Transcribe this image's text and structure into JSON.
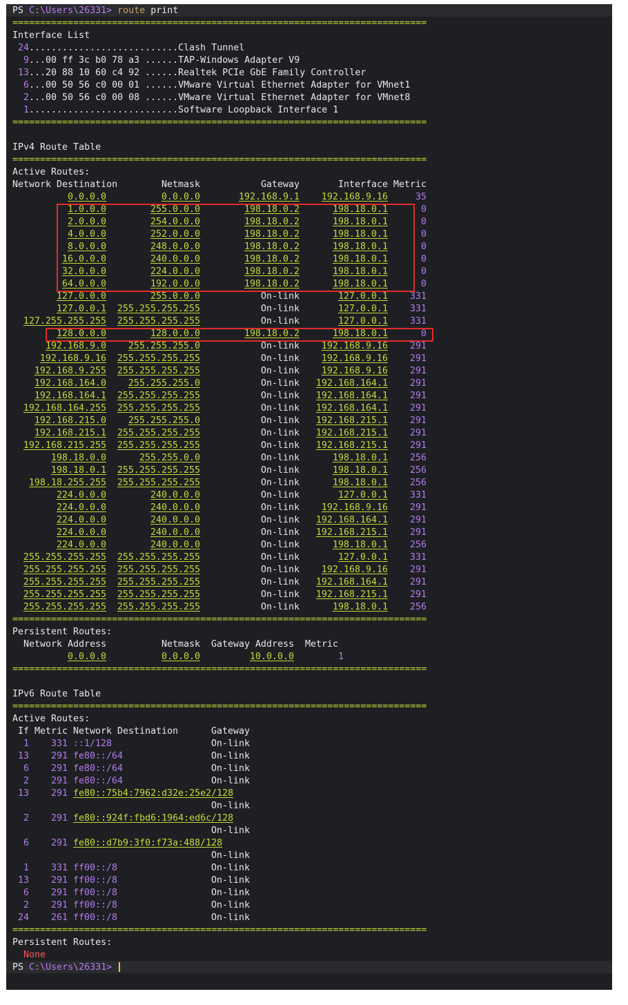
{
  "window": {
    "prompt": "PS",
    "path": "C:\\Users\\26331>",
    "command": "route",
    "command_arg": "print"
  },
  "separator": "===========================================================================",
  "interface_list": {
    "title": "Interface List",
    "items": [
      {
        "num": "24",
        "mac": "",
        "dots": "...........................",
        "name": "Clash Tunnel"
      },
      {
        "num": "9",
        "mac": "...00 ff 3c b0 78 a3 ",
        "dots": "......",
        "name": "TAP-Windows Adapter V9"
      },
      {
        "num": "13",
        "mac": "...20 88 10 60 c4 92 ",
        "dots": "......",
        "name": "Realtek PCIe GbE Family Controller"
      },
      {
        "num": "6",
        "mac": "...00 50 56 c0 00 01 ",
        "dots": "......",
        "name": "VMware Virtual Ethernet Adapter for VMnet1"
      },
      {
        "num": "2",
        "mac": "...00 50 56 c0 00 08 ",
        "dots": "......",
        "name": "VMware Virtual Ethernet Adapter for VMnet8"
      },
      {
        "num": "1",
        "mac": "",
        "dots": "...........................",
        "name": "Software Loopback Interface 1"
      }
    ]
  },
  "ipv4": {
    "title": "IPv4 Route Table",
    "active_title": "Active Routes:",
    "headers": [
      "Network Destination",
      "Netmask",
      "Gateway",
      "Interface",
      "Metric"
    ],
    "rows": [
      [
        "0.0.0.0",
        "0.0.0.0",
        "192.168.9.1",
        "192.168.9.16",
        "35"
      ],
      [
        "1.0.0.0",
        "255.0.0.0",
        "198.18.0.2",
        "198.18.0.1",
        "0"
      ],
      [
        "2.0.0.0",
        "254.0.0.0",
        "198.18.0.2",
        "198.18.0.1",
        "0"
      ],
      [
        "4.0.0.0",
        "252.0.0.0",
        "198.18.0.2",
        "198.18.0.1",
        "0"
      ],
      [
        "8.0.0.0",
        "248.0.0.0",
        "198.18.0.2",
        "198.18.0.1",
        "0"
      ],
      [
        "16.0.0.0",
        "240.0.0.0",
        "198.18.0.2",
        "198.18.0.1",
        "0"
      ],
      [
        "32.0.0.0",
        "224.0.0.0",
        "198.18.0.2",
        "198.18.0.1",
        "0"
      ],
      [
        "64.0.0.0",
        "192.0.0.0",
        "198.18.0.2",
        "198.18.0.1",
        "0"
      ],
      [
        "127.0.0.0",
        "255.0.0.0",
        "On-link",
        "127.0.0.1",
        "331"
      ],
      [
        "127.0.0.1",
        "255.255.255.255",
        "On-link",
        "127.0.0.1",
        "331"
      ],
      [
        "127.255.255.255",
        "255.255.255.255",
        "On-link",
        "127.0.0.1",
        "331"
      ],
      [
        "128.0.0.0",
        "128.0.0.0",
        "198.18.0.2",
        "198.18.0.1",
        "0"
      ],
      [
        "192.168.9.0",
        "255.255.255.0",
        "On-link",
        "192.168.9.16",
        "291"
      ],
      [
        "192.168.9.16",
        "255.255.255.255",
        "On-link",
        "192.168.9.16",
        "291"
      ],
      [
        "192.168.9.255",
        "255.255.255.255",
        "On-link",
        "192.168.9.16",
        "291"
      ],
      [
        "192.168.164.0",
        "255.255.255.0",
        "On-link",
        "192.168.164.1",
        "291"
      ],
      [
        "192.168.164.1",
        "255.255.255.255",
        "On-link",
        "192.168.164.1",
        "291"
      ],
      [
        "192.168.164.255",
        "255.255.255.255",
        "On-link",
        "192.168.164.1",
        "291"
      ],
      [
        "192.168.215.0",
        "255.255.255.0",
        "On-link",
        "192.168.215.1",
        "291"
      ],
      [
        "192.168.215.1",
        "255.255.255.255",
        "On-link",
        "192.168.215.1",
        "291"
      ],
      [
        "192.168.215.255",
        "255.255.255.255",
        "On-link",
        "192.168.215.1",
        "291"
      ],
      [
        "198.18.0.0",
        "255.255.0.0",
        "On-link",
        "198.18.0.1",
        "256"
      ],
      [
        "198.18.0.1",
        "255.255.255.255",
        "On-link",
        "198.18.0.1",
        "256"
      ],
      [
        "198.18.255.255",
        "255.255.255.255",
        "On-link",
        "198.18.0.1",
        "256"
      ],
      [
        "224.0.0.0",
        "240.0.0.0",
        "On-link",
        "127.0.0.1",
        "331"
      ],
      [
        "224.0.0.0",
        "240.0.0.0",
        "On-link",
        "192.168.9.16",
        "291"
      ],
      [
        "224.0.0.0",
        "240.0.0.0",
        "On-link",
        "192.168.164.1",
        "291"
      ],
      [
        "224.0.0.0",
        "240.0.0.0",
        "On-link",
        "192.168.215.1",
        "291"
      ],
      [
        "224.0.0.0",
        "240.0.0.0",
        "On-link",
        "198.18.0.1",
        "256"
      ],
      [
        "255.255.255.255",
        "255.255.255.255",
        "On-link",
        "127.0.0.1",
        "331"
      ],
      [
        "255.255.255.255",
        "255.255.255.255",
        "On-link",
        "192.168.9.16",
        "291"
      ],
      [
        "255.255.255.255",
        "255.255.255.255",
        "On-link",
        "192.168.164.1",
        "291"
      ],
      [
        "255.255.255.255",
        "255.255.255.255",
        "On-link",
        "192.168.215.1",
        "291"
      ],
      [
        "255.255.255.255",
        "255.255.255.255",
        "On-link",
        "198.18.0.1",
        "256"
      ]
    ],
    "persistent_title": "Persistent Routes:",
    "persistent_headers": [
      "Network Address",
      "Netmask",
      "Gateway Address",
      "Metric"
    ],
    "persistent_rows": [
      [
        "0.0.0.0",
        "0.0.0.0",
        "10.0.0.0",
        "1"
      ]
    ]
  },
  "ipv6": {
    "title": "IPv6 Route Table",
    "active_title": "Active Routes:",
    "headers": [
      "If",
      "Metric",
      "Network Destination",
      "Gateway"
    ],
    "rows": [
      {
        "if": "1",
        "metric": "331",
        "dest": "::1/128",
        "gw": "On-link",
        "wrap": false
      },
      {
        "if": "13",
        "metric": "291",
        "dest": "fe80::/64",
        "gw": "On-link",
        "wrap": false
      },
      {
        "if": "6",
        "metric": "291",
        "dest": "fe80::/64",
        "gw": "On-link",
        "wrap": false
      },
      {
        "if": "2",
        "metric": "291",
        "dest": "fe80::/64",
        "gw": "On-link",
        "wrap": false
      },
      {
        "if": "13",
        "metric": "291",
        "dest": "fe80::75b4:7962:d32e:25e2/128",
        "gw": "On-link",
        "wrap": true
      },
      {
        "if": "2",
        "metric": "291",
        "dest": "fe80::924f:fbd6:1964:ed6c/128",
        "gw": "On-link",
        "wrap": true
      },
      {
        "if": "6",
        "metric": "291",
        "dest": "fe80::d7b9:3f0:f73a:488/128",
        "gw": "On-link",
        "wrap": true
      },
      {
        "if": "1",
        "metric": "331",
        "dest": "ff00::/8",
        "gw": "On-link",
        "wrap": false
      },
      {
        "if": "13",
        "metric": "291",
        "dest": "ff00::/8",
        "gw": "On-link",
        "wrap": false
      },
      {
        "if": "6",
        "metric": "291",
        "dest": "ff00::/8",
        "gw": "On-link",
        "wrap": false
      },
      {
        "if": "2",
        "metric": "291",
        "dest": "ff00::/8",
        "gw": "On-link",
        "wrap": false
      },
      {
        "if": "24",
        "metric": "261",
        "dest": "ff00::/8",
        "gw": "On-link",
        "wrap": false
      }
    ],
    "persistent_title": "Persistent Routes:",
    "persistent_value": "None"
  },
  "colors": {
    "background": "#1e1f22",
    "accent_yellow": "#c5d93a",
    "number_purple": "#b57bf0",
    "highlight_red": "#e22b2b",
    "none_red": "#ff5555"
  }
}
